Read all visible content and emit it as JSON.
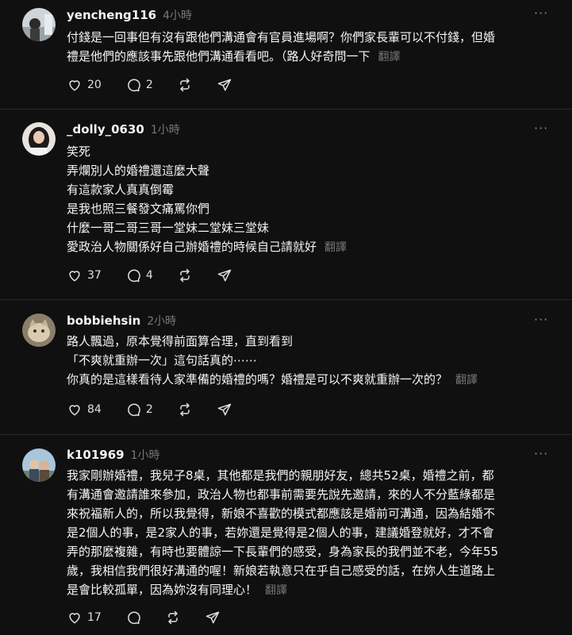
{
  "translate_label": "翻譯",
  "posts": [
    {
      "username": "yencheng116",
      "time": "4小時",
      "lines": [
        "付錢是一回事但有沒有跟他們溝通會有官員進場啊？你們家長輩可以不付錢，但婚",
        "禮是他們的應該事先跟他們溝通看看吧。（路人好奇問一下"
      ],
      "likes": "20",
      "replies": "2"
    },
    {
      "username": "_dolly_0630",
      "time": "1小時",
      "lines": [
        "笑死",
        "弄爛別人的婚禮還這麼大聲",
        "有這款家人真真倒霉",
        "是我也照三餐發文痛罵你們",
        "什麼一哥二哥三哥一堂妹二堂妹三堂妹",
        "愛政治人物關係好自己辦婚禮的時候自己請就好"
      ],
      "likes": "37",
      "replies": "4"
    },
    {
      "username": "bobbiehsin",
      "time": "2小時",
      "lines": [
        "路人飄過，原本覺得前面算合理，直到看到",
        "「不爽就重辦一次」這句話真的⋯⋯",
        "你真的是這樣看待人家準備的婚禮的嗎？婚禮是可以不爽就重辦一次的？"
      ],
      "likes": "84",
      "replies": "2"
    },
    {
      "username": "k101969",
      "time": "1小時",
      "lines": [
        "我家剛辦婚禮，我兒子8桌，其他都是我們的親朋好友，總共52桌，婚禮之前，都",
        "有溝通會邀請誰來參加，政治人物也都事前需要先說先邀請，來的人不分藍綠都是",
        "來祝福新人的，所以我覺得，新娘不喜歡的模式都應該是婚前可溝通，因為結婚不",
        "是2個人的事，是2家人的事，若妳還是覺得是2個人的事，建議婚登就好，才不會",
        "弄的那麼複雜，有時也要體諒一下長輩們的感受，身為家長的我們並不老，今年55",
        "歲，我相信我們很好溝通的喔！新娘若執意只在乎自己感受的話，在妳人生道路上",
        "是會比較孤單，因為妳沒有同理心！"
      ],
      "likes": "17",
      "replies": ""
    }
  ]
}
